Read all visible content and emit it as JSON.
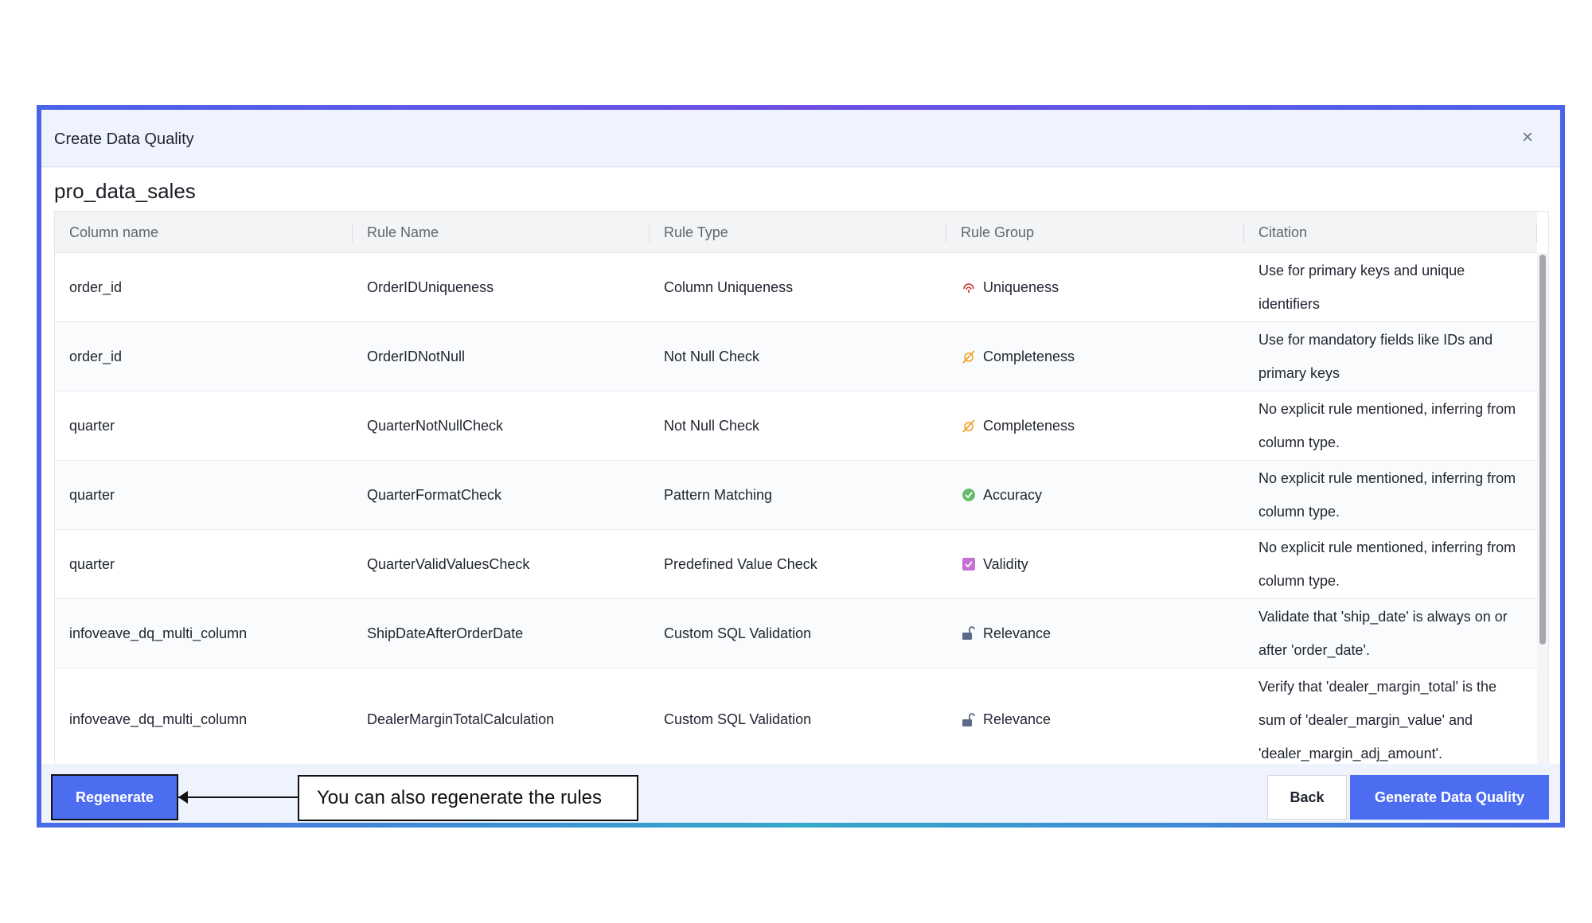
{
  "dialog": {
    "title": "Create Data Quality",
    "close_icon": "close-icon"
  },
  "table_name": "pro_data_sales",
  "columns": [
    "Column name",
    "Rule Name",
    "Rule Type",
    "Rule Group",
    "Citation"
  ],
  "rows": [
    {
      "column": "order_id",
      "rule_name": "OrderIDUniqueness",
      "rule_type": "Column Uniqueness",
      "group": "Uniqueness",
      "group_icon": "fingerprint-icon",
      "citation": "Use for primary keys and unique identifiers"
    },
    {
      "column": "order_id",
      "rule_name": "OrderIDNotNull",
      "rule_type": "Not Null Check",
      "group": "Completeness",
      "group_icon": "slash-icon",
      "citation": "Use for mandatory fields like IDs and primary keys"
    },
    {
      "column": "quarter",
      "rule_name": "QuarterNotNullCheck",
      "rule_type": "Not Null Check",
      "group": "Completeness",
      "group_icon": "slash-icon",
      "citation": "No explicit rule mentioned, inferring from column type."
    },
    {
      "column": "quarter",
      "rule_name": "QuarterFormatCheck",
      "rule_type": "Pattern Matching",
      "group": "Accuracy",
      "group_icon": "check-circle-icon",
      "citation": "No explicit rule mentioned, inferring from column type."
    },
    {
      "column": "quarter",
      "rule_name": "QuarterValidValuesCheck",
      "rule_type": "Predefined Value Check",
      "group": "Validity",
      "group_icon": "checkbox-icon",
      "citation": "No explicit rule mentioned, inferring from column type."
    },
    {
      "column": "infoveave_dq_multi_column",
      "rule_name": "ShipDateAfterOrderDate",
      "rule_type": "Custom SQL Validation",
      "group": "Relevance",
      "group_icon": "unlock-icon",
      "citation": "Validate that 'ship_date' is always on or after 'order_date'."
    },
    {
      "column": "infoveave_dq_multi_column",
      "rule_name": "DealerMarginTotalCalculation",
      "rule_type": "Custom SQL Validation",
      "group": "Relevance",
      "group_icon": "unlock-icon",
      "citation": "Verify that 'dealer_margin_total' is the sum of 'dealer_margin_value' and 'dealer_margin_adj_amount'."
    }
  ],
  "footer": {
    "regenerate_label": "Regenerate",
    "callout_text": "You can also regenerate the rules",
    "back_label": "Back",
    "generate_label": "Generate Data Quality"
  },
  "colors": {
    "accent": "#4d6df0",
    "frame": "#6f4fe3",
    "uniqueness_icon": "#c0392b",
    "completeness_icon": "#f0a020",
    "accuracy_icon": "#4caf50",
    "validity_icon": "#c471d4",
    "relevance_icon": "#5a6a88"
  }
}
